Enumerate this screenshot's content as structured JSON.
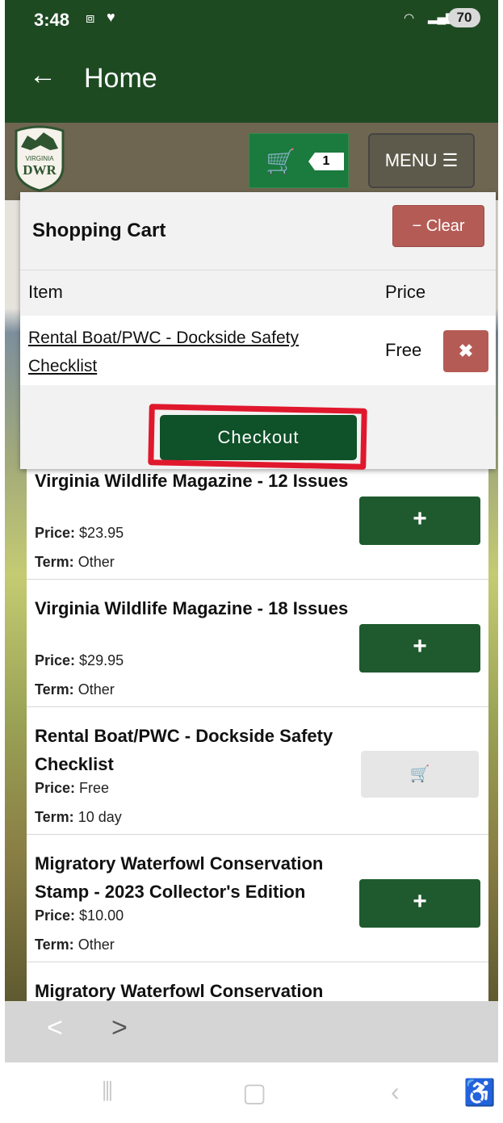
{
  "status_bar": {
    "time": "3:48",
    "battery": "70"
  },
  "app_bar": {
    "back": "←",
    "title": "Home"
  },
  "logo": {
    "text_top": "VIRGINIA",
    "text_main": "DWR"
  },
  "header": {
    "cart_count": "1",
    "menu_label": "MENU ☰"
  },
  "cart": {
    "title": "Shopping Cart",
    "clear_label": "− Clear",
    "col_item": "Item",
    "col_price": "Price",
    "items": [
      {
        "name": "Rental Boat/PWC - Dockside Safety Checklist",
        "price": "Free",
        "remove": "✖"
      }
    ],
    "checkout_label": "Checkout"
  },
  "products": [
    {
      "title": "Virginia Wildlife Magazine - 12 Issues",
      "price_label": "Price:",
      "price": "$23.95",
      "term_label": "Term:",
      "term": "Other",
      "action": "+"
    },
    {
      "title": "Virginia Wildlife Magazine - 18 Issues",
      "price_label": "Price:",
      "price": "$29.95",
      "term_label": "Term:",
      "term": "Other",
      "action": "+"
    },
    {
      "title": "Rental Boat/PWC - Dockside Safety Checklist",
      "price_label": "Price:",
      "price": "Free",
      "term_label": "Term:",
      "term": "10 day",
      "action": "cart-icon"
    },
    {
      "title": "Migratory Waterfowl Conservation Stamp - 2023 Collector's Edition",
      "price_label": "Price:",
      "price": "$10.00",
      "term_label": "Term:",
      "term": "Other",
      "action": "+"
    },
    {
      "title": "Migratory Waterfowl Conservation"
    }
  ],
  "pager": {
    "prev": "<",
    "next": ">"
  },
  "colors": {
    "primary_green": "#1e4a22",
    "button_green": "#1e5a2e",
    "danger": "#b55b55",
    "highlight": "#e0182d"
  }
}
